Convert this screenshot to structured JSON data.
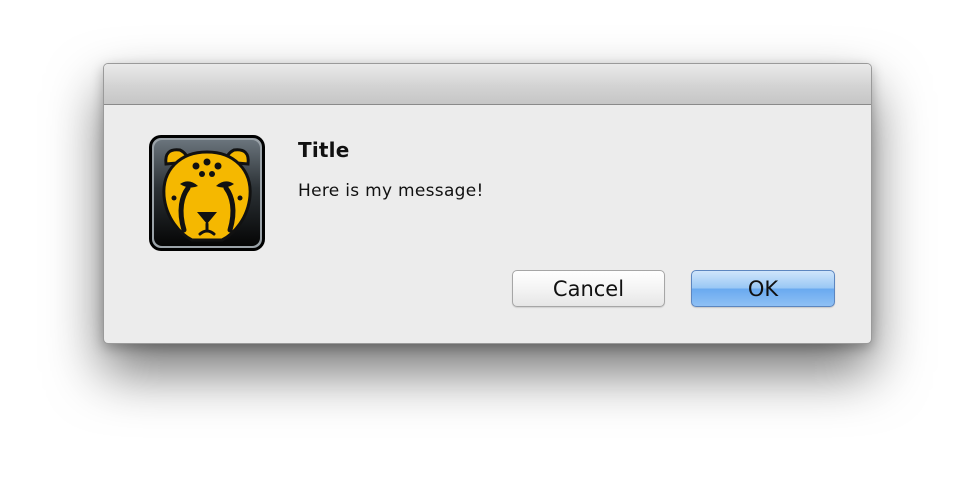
{
  "dialog": {
    "icon": "cheetah-app-icon",
    "title": "Title",
    "message": "Here is my message!",
    "buttons": {
      "cancel_label": "Cancel",
      "ok_label": "OK"
    }
  },
  "colors": {
    "icon_yellow": "#f5b800",
    "default_button": "#8fc0f4"
  }
}
